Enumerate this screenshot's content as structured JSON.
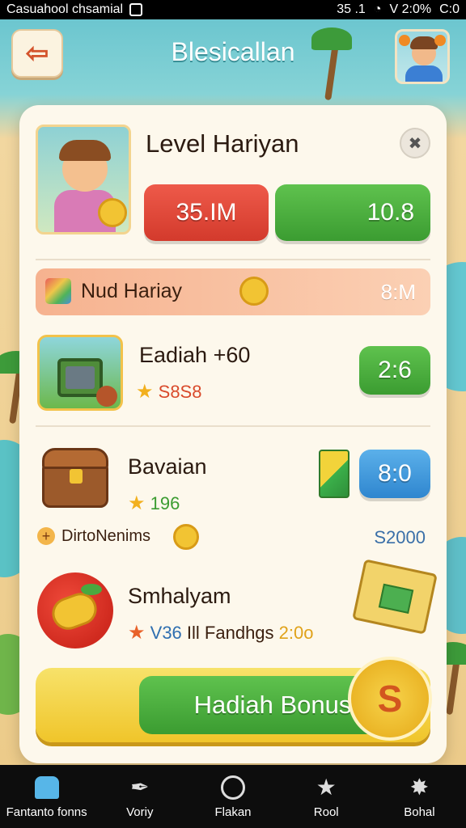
{
  "status_bar": {
    "carrier": "Casuahool chsamial",
    "right_text": "35 .1",
    "battery_text": "V 2:0%",
    "extra": "C:0"
  },
  "header": {
    "title": "Blesicallan"
  },
  "level_card": {
    "title": "Level Hariyan",
    "red_value": "35.IM",
    "green_value": "10.8"
  },
  "sub_bar": {
    "label": "Nud Hariay",
    "value": "8:M"
  },
  "rows": [
    {
      "title": "Eadiah +60",
      "sub_value": "S8S8",
      "button": "2:6"
    },
    {
      "title": "Bavaian",
      "sub_value": "196",
      "button": "8:0"
    },
    {
      "title": "Smhalyam",
      "sub_prefix": "V36",
      "sub_text": "Ill Fandhgs",
      "sub_value": "2:0o"
    }
  ],
  "info_line": {
    "label": "DirtoNenims",
    "value": "S2000"
  },
  "bonus": {
    "label": "Hadiah Bonus",
    "badge_symbol": "S"
  },
  "bottom_nav": {
    "items": [
      {
        "label": "Fantanto fonns",
        "icon": "home-icon"
      },
      {
        "label": "Voriy",
        "icon": "feather-icon"
      },
      {
        "label": "Flakan",
        "icon": "compass-icon"
      },
      {
        "label": "Rool",
        "icon": "star-icon"
      },
      {
        "label": "Bohal",
        "icon": "sparkle-icon"
      }
    ]
  },
  "colors": {
    "accent_green": "#3b9c31",
    "accent_red": "#d33a2c",
    "accent_blue": "#2f86cf",
    "gold": "#f2c433"
  }
}
